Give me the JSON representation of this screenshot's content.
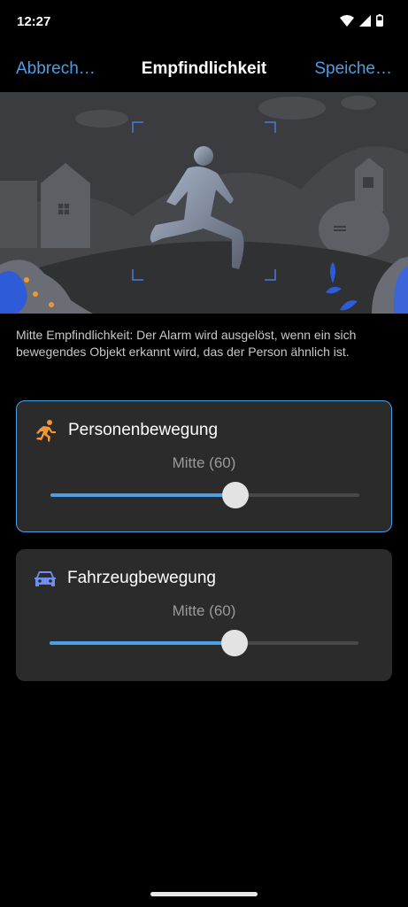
{
  "status": {
    "time": "12:27"
  },
  "header": {
    "cancel_label": "Abbrech…",
    "title": "Empfindlichkeit",
    "save_label": "Speiche…"
  },
  "description": "Mitte Empfindlichkeit: Der Alarm wird ausgelöst, wenn ein sich bewegendes Objekt erkannt wird, das der Person ähnlich ist.",
  "cards": [
    {
      "title": "Personenbewegung",
      "icon": "running-person-icon",
      "icon_color": "#f0963a",
      "value_label": "Mitte (60)",
      "level_fraction": 0.6,
      "selected": true
    },
    {
      "title": "Fahrzeugbewegung",
      "icon": "car-icon",
      "icon_color": "#6e8ff0",
      "value_label": "Mitte (60)",
      "level_fraction": 0.6,
      "selected": false
    }
  ],
  "colors": {
    "accent": "#4a9fe6",
    "card_bg": "#2b2b2b",
    "background": "#000000"
  }
}
